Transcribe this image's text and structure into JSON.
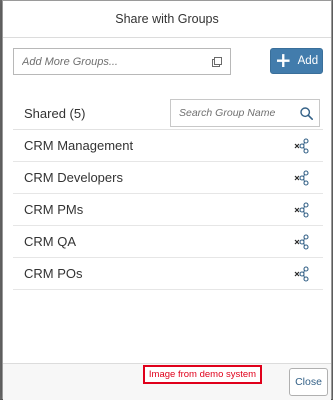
{
  "dialog": {
    "title": "Share with Groups"
  },
  "add_groups": {
    "placeholder": "Add More Groups...",
    "value_help_icon": "value-help-icon"
  },
  "add_button": {
    "icon": "plus-icon",
    "label": "Add"
  },
  "shared": {
    "title": "Shared (5)",
    "search_placeholder": "Search Group Name",
    "search_icon": "search-icon",
    "items": [
      {
        "label": "CRM Management"
      },
      {
        "label": "CRM Developers"
      },
      {
        "label": "CRM PMs"
      },
      {
        "label": "CRM QA"
      },
      {
        "label": "CRM POs"
      }
    ],
    "item_action_icon": "unshare-icon"
  },
  "footer": {
    "close_label": "Close",
    "watermark_text": "Image from demo system"
  },
  "colors": {
    "accent": "#427cac",
    "watermark": "#e0001b",
    "text": "#333333"
  }
}
